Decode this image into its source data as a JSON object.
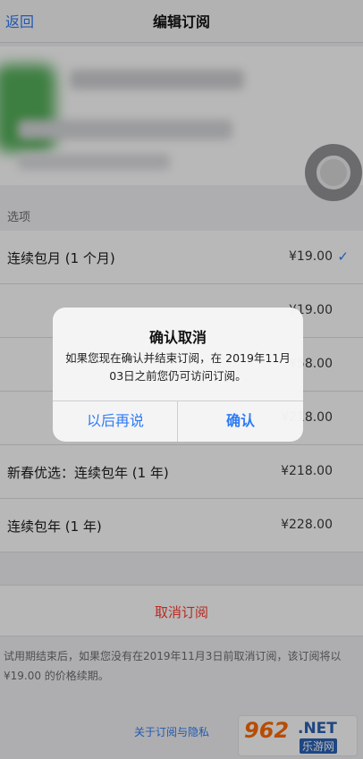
{
  "nav": {
    "back_label": "返回",
    "title": "编辑订阅"
  },
  "options_section": {
    "header": "选项"
  },
  "options": [
    {
      "label": "连续包月 (1 个月)",
      "price": "¥19.00",
      "selected": true
    },
    {
      "label": "",
      "price": "¥19.00",
      "selected": false
    },
    {
      "label": "",
      "price": "¥58.00",
      "selected": false
    },
    {
      "label": "",
      "price": "¥218.00",
      "selected": false
    },
    {
      "label": "新春优选：连续包年 (1 年)",
      "price": "¥218.00",
      "selected": false
    },
    {
      "label": "连续包年 (1 年)",
      "price": "¥228.00",
      "selected": false
    }
  ],
  "cancel_label": "取消订阅",
  "footer_note": "试用期结束后，如果您没有在2019年11月3日前取消订阅，该订阅将以 ¥19.00 的价格续期。",
  "footer_link": "关于订阅与隐私",
  "alert": {
    "title": "确认取消",
    "message": "如果您现在确认并结束订阅，在 2019年11月03日之前您仍可访问订阅。",
    "cancel_button": "以后再说",
    "confirm_button": "确认"
  },
  "watermark": {
    "number": "962",
    "domain": ".NET",
    "name": "乐游网"
  },
  "colors": {
    "accent": "#2e7cf6",
    "destructive": "#ff3b30"
  }
}
